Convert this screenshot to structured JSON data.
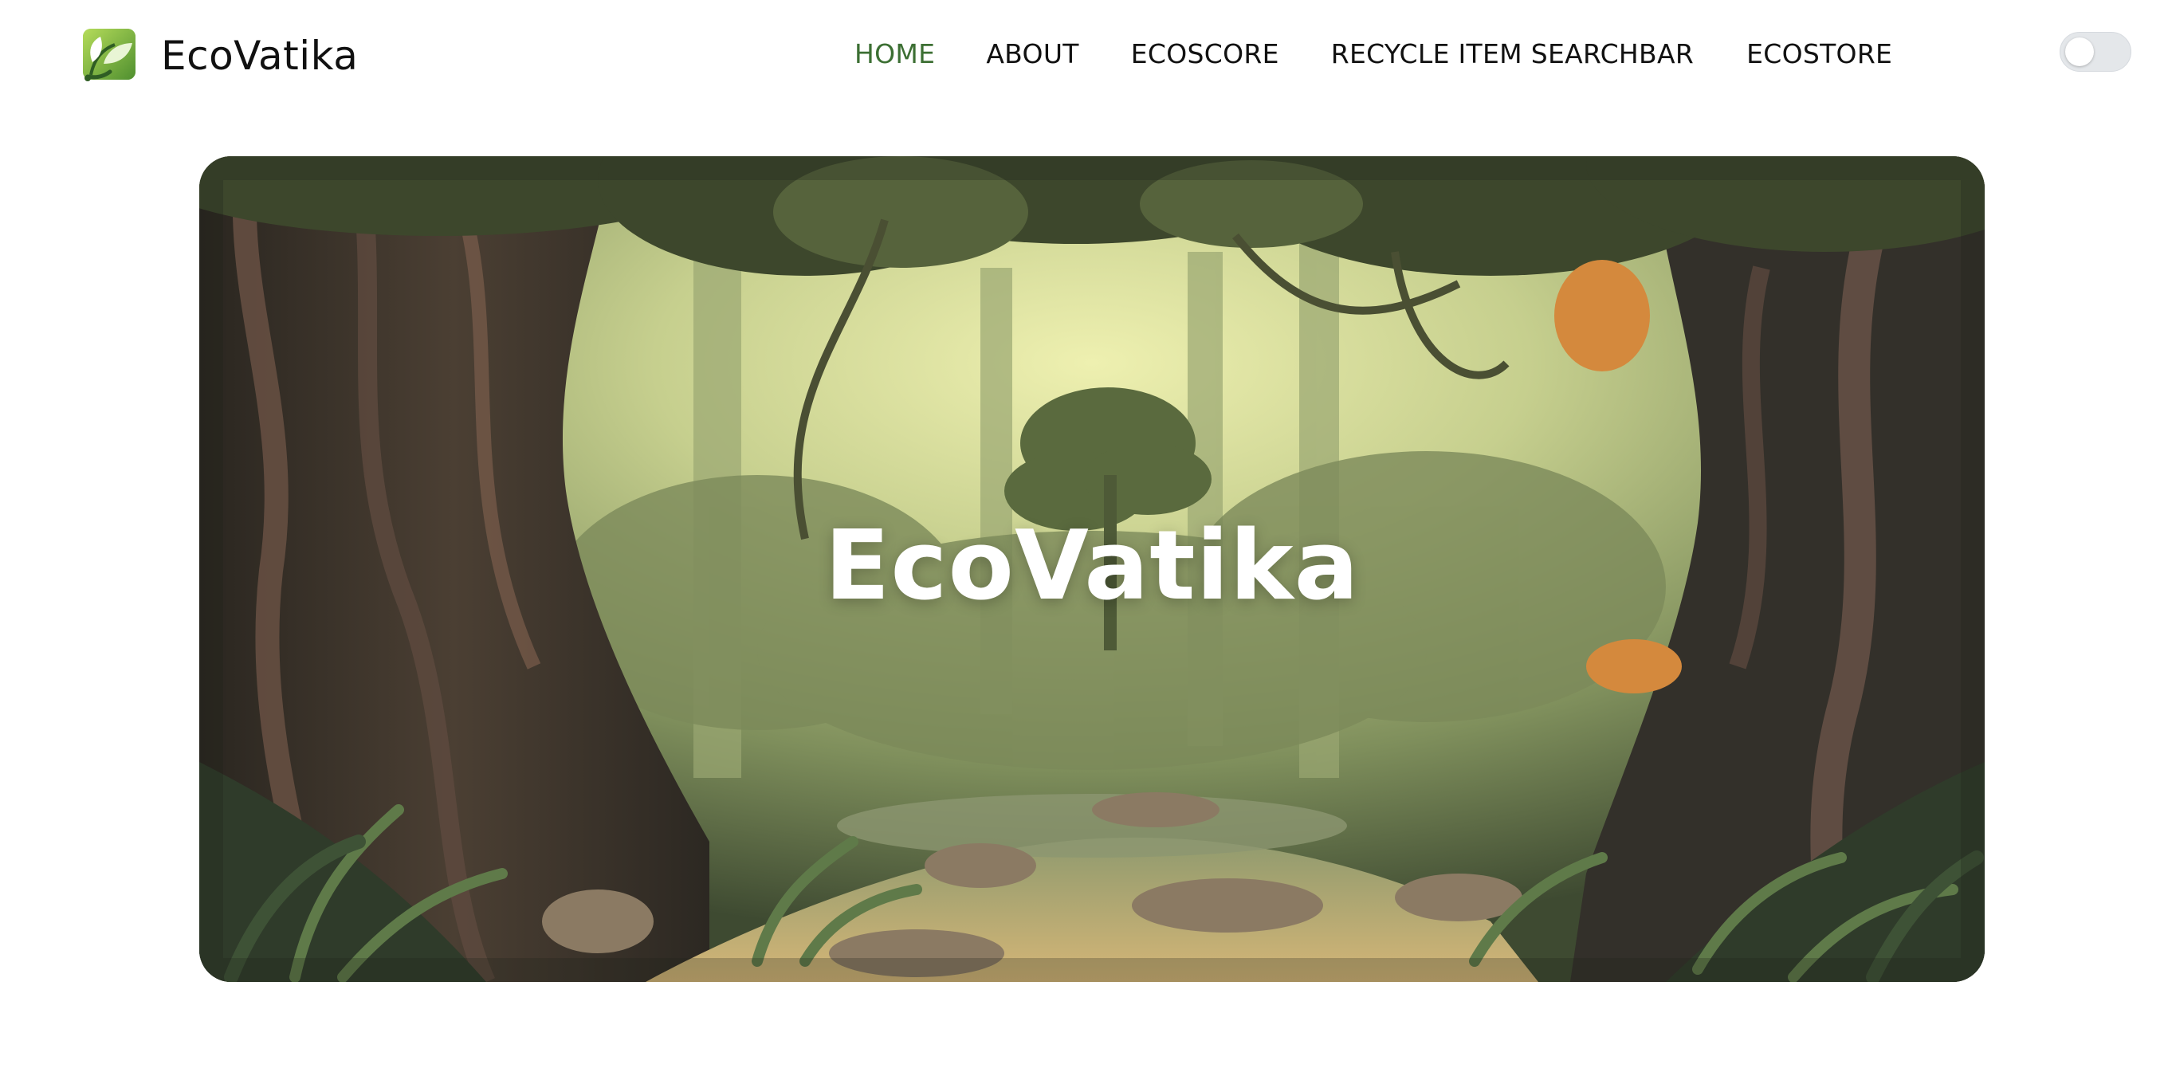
{
  "header": {
    "brand": {
      "name": "EcoVatika",
      "logo_icon": "leaf-logo-icon"
    },
    "nav": [
      {
        "label": "HOME",
        "active": true
      },
      {
        "label": "ABOUT",
        "active": false
      },
      {
        "label": "ECOSCORE",
        "active": false
      },
      {
        "label": "RECYCLE ITEM SEARCHBAR",
        "active": false
      },
      {
        "label": "ECOSTORE",
        "active": false
      }
    ],
    "theme_toggle": {
      "state": "off"
    }
  },
  "hero": {
    "title": "EcoVatika",
    "background": "illustrated jungle forest scene"
  },
  "colors": {
    "accent": "#3c6f33",
    "text": "#111111",
    "background": "#ffffff"
  }
}
